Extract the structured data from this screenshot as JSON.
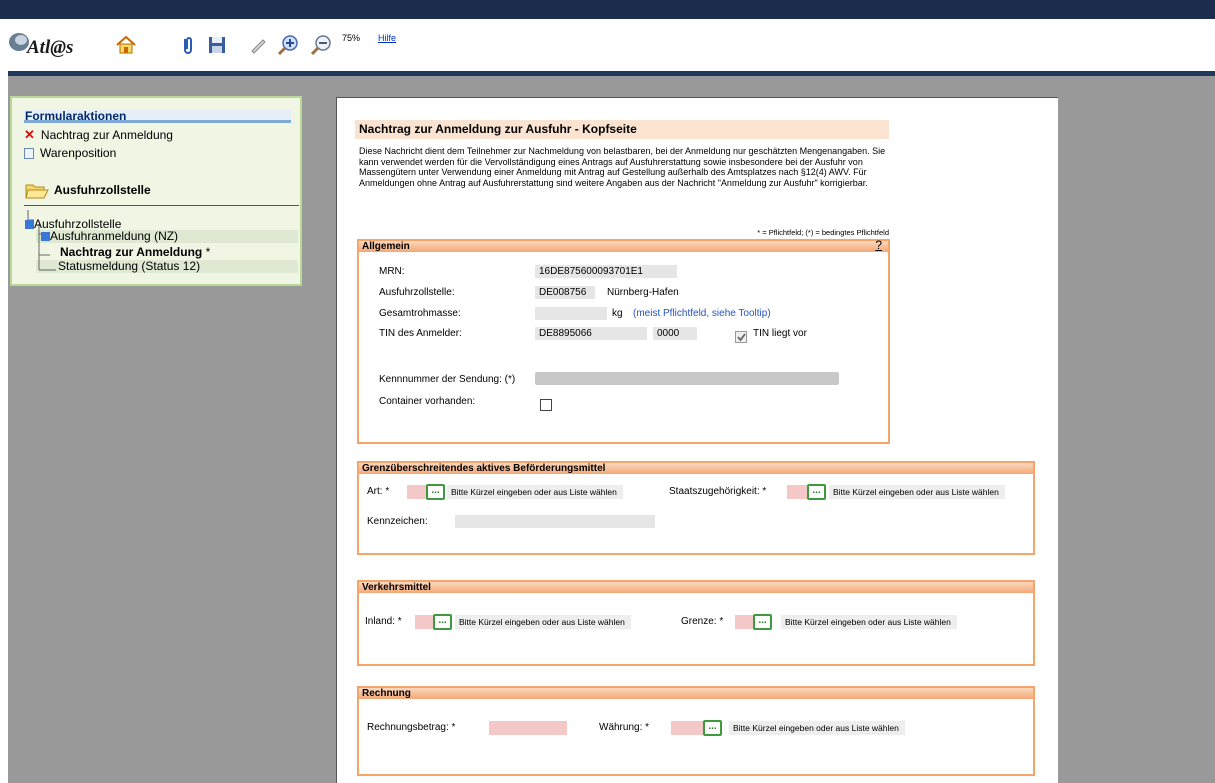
{
  "app": {
    "logo_text": "Atl@s",
    "zoom": "75%",
    "help_label": "Hilfe"
  },
  "toolbar": {
    "icons": [
      "home-icon",
      "paperclip-icon",
      "save-icon",
      "pen-icon",
      "zoom-in-icon",
      "zoom-out-icon"
    ]
  },
  "sidebar": {
    "heading": "Formularaktionen",
    "actions": [
      {
        "label": "Nachtrag zur Anmeldung",
        "icon": "cross-icon"
      },
      {
        "label": "Warenposition",
        "icon": "page-icon"
      }
    ],
    "section_title": "Ausfuhrzollstelle",
    "tree": {
      "root": "Ausfuhrzollstelle",
      "child": "Ausfuhranmeldung (NZ)",
      "current": "Nachtrag zur Anmeldung",
      "current_mark": "*",
      "status": "Statusmeldung (Status 12)"
    }
  },
  "doc": {
    "title": "Nachtrag zur Anmeldung zur Ausfuhr - Kopfseite",
    "intro": "Diese Nachricht dient dem Teilnehmer zur Nachmeldung von belastbaren, bei der Anmeldung nur geschätzten Mengenangaben. Sie kann verwendet werden für die Vervollständigung eines Antrags auf Ausfuhrerstattung sowie insbesondere bei der Ausfuhr von Massengütern unter Verwendung einer Anmeldung mit Antrag auf Gestellung außerhalb des Amtsplatzes nach §12(4) AWV. Für Anmeldungen ohne Antrag auf Ausfuhrerstattung sind weitere Angaben aus der Nachricht \"Anmeldung zur Ausfuhr\" korrigierbar.",
    "legend": "* = Pflichtfeld; (*) = bedingtes Pflichtfeld"
  },
  "allgemein": {
    "title": "Allgemein",
    "help": "?",
    "mrn_label": "MRN:",
    "mrn_value": "16DE875600093701E1",
    "zollstelle_label": "Ausfuhrzollstelle:",
    "zollstelle_code": "DE008756",
    "zollstelle_name": "Nürnberg-Hafen",
    "masse_label": "Gesamtrohmasse:",
    "masse_unit": "kg",
    "masse_note": "(meist Pflichtfeld, siehe Tooltip)",
    "tin_label": "TIN des Anmelder:",
    "tin_value": "DE8895066",
    "tin_suffix": "0000",
    "tin_check_label": "TIN liegt vor",
    "kenn_label": "Kennnummer der Sendung: (*)",
    "container_label": "Container vorhanden:"
  },
  "grenz": {
    "title": "Grenzüberschreitendes aktives Beförderungsmittel",
    "art_label": "Art: *",
    "art_hint": "Bitte Kürzel eingeben oder aus Liste wählen",
    "staat_label": "Staatszugehörigkeit: *",
    "staat_hint": "Bitte Kürzel eingeben oder aus Liste wählen",
    "kennz_label": "Kennzeichen:",
    "list_btn": "..."
  },
  "verkehr": {
    "title": "Verkehrsmittel",
    "inland_label": "Inland: *",
    "inland_hint": "Bitte Kürzel eingeben oder aus Liste wählen",
    "grenze_label": "Grenze: *",
    "grenze_hint": "Bitte Kürzel eingeben oder aus Liste wählen",
    "list_btn": "..."
  },
  "rechnung": {
    "title": "Rechnung",
    "betrag_label": "Rechnungsbetrag: *",
    "waehrung_label": "Währung: *",
    "waehrung_hint": "Bitte Kürzel eingeben oder aus Liste wählen",
    "list_btn": "..."
  },
  "colors": {
    "accent_orange": "#f5a56a",
    "required_pink": "#f5c8c8",
    "list_green": "#3d9a3d",
    "header_navy": "#1c2c4c"
  }
}
